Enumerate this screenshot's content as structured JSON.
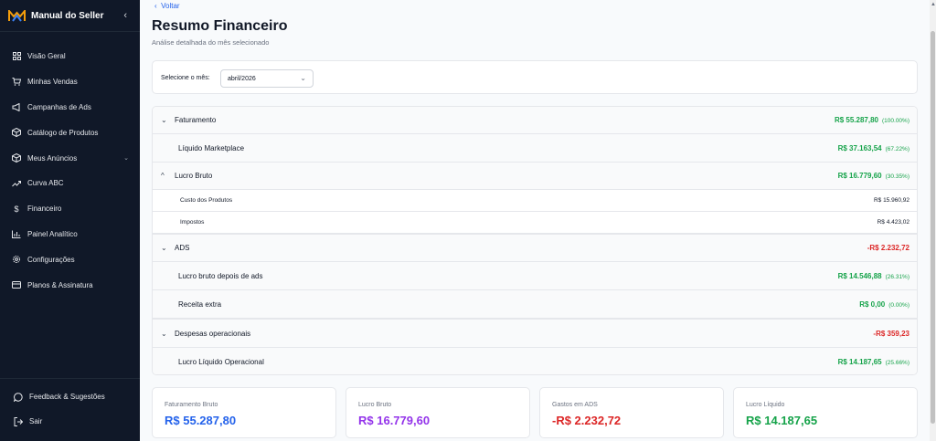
{
  "sidebar": {
    "brand": "Manual do Seller",
    "items": [
      {
        "label": "Visão Geral",
        "icon": "grid-icon"
      },
      {
        "label": "Minhas Vendas",
        "icon": "cart-icon"
      },
      {
        "label": "Campanhas de Ads",
        "icon": "megaphone-icon"
      },
      {
        "label": "Catálogo de Produtos",
        "icon": "box-icon"
      },
      {
        "label": "Meus Anúncios",
        "icon": "box-icon"
      },
      {
        "label": "Curva ABC",
        "icon": "trend-icon"
      },
      {
        "label": "Financeiro",
        "icon": "dollar-icon"
      },
      {
        "label": "Painel Analítico",
        "icon": "bar-chart-icon"
      },
      {
        "label": "Configurações",
        "icon": "gear-icon"
      },
      {
        "label": "Planos & Assinatura",
        "icon": "card-icon"
      }
    ],
    "bottom": [
      {
        "label": "Feedback & Sugestões",
        "icon": "chat-icon"
      },
      {
        "label": "Sair",
        "icon": "logout-icon"
      }
    ]
  },
  "header": {
    "back": "Voltar",
    "title": "Resumo Financeiro",
    "subtitle": "Análise detalhada do mês selecionado"
  },
  "selector": {
    "label": "Selecione o mês:",
    "value": "abril/2026"
  },
  "table": {
    "faturamento": {
      "label": "Faturamento",
      "value": "R$ 55.287,80",
      "pct": "(100.00%)"
    },
    "liquido": {
      "label": "Líquido Marketplace",
      "value": "R$ 37.163,54",
      "pct": "(67.22%)"
    },
    "lucro_bruto": {
      "label": "Lucro Bruto",
      "value": "R$ 16.779,60",
      "pct": "(30.35%)"
    },
    "custo": {
      "label": "Custo dos Produtos",
      "value": "R$ 15.960,92"
    },
    "impostos": {
      "label": "Impostos",
      "value": "R$ 4.423,02"
    },
    "ads": {
      "label": "ADS",
      "value": "-R$ 2.232,72"
    },
    "lucro_apos_ads": {
      "label": "Lucro bruto depois de ads",
      "value": "R$ 14.546,88",
      "pct": "(26.31%)"
    },
    "receita_extra": {
      "label": "Receita extra",
      "value": "R$ 0,00",
      "pct": "(0.00%)"
    },
    "despesas": {
      "label": "Despesas operacionais",
      "value": "-R$ 359,23"
    },
    "lucro_liquido": {
      "label": "Lucro Líquido Operacional",
      "value": "R$ 14.187,65",
      "pct": "(25.66%)"
    }
  },
  "cards": [
    {
      "title": "Faturamento Bruto",
      "value": "R$ 55.287,80",
      "color": "#2563eb"
    },
    {
      "title": "Lucro Bruto",
      "value": "R$ 16.779,60",
      "color": "#9333ea"
    },
    {
      "title": "Gastos em ADS",
      "value": "-R$ 2.232,72",
      "color": "#dc2626"
    },
    {
      "title": "Lucro Líquido",
      "value": "R$ 14.187,65",
      "color": "#16a34a"
    }
  ]
}
